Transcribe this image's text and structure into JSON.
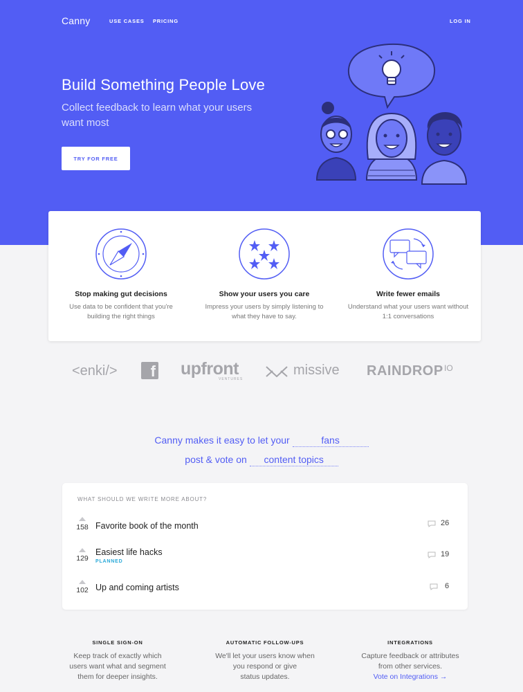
{
  "header": {
    "logo": "Canny",
    "nav": [
      "USE CASES",
      "PRICING"
    ],
    "login": "LOG IN"
  },
  "hero": {
    "title": "Build Something People Love",
    "subtitle": "Collect feedback to learn what your users want most",
    "cta": "TRY FOR FREE",
    "illustration": "people-with-lightbulb-speech-bubble"
  },
  "features": [
    {
      "icon": "compass-icon",
      "title": "Stop making gut decisions",
      "desc": "Use data to be confident that you're building the right things"
    },
    {
      "icon": "stars-icon",
      "title": "Show your users you care",
      "desc": "Impress your users by simply listening to what they have to say."
    },
    {
      "icon": "chat-bubbles-icon",
      "title": "Write fewer emails",
      "desc": "Understand what your users want without 1:1 conversations"
    }
  ],
  "logos": {
    "enki": "<enki/>",
    "facebook": "f",
    "upfront": "upfront",
    "upfront_sub": "VENTURES",
    "missive": "missive",
    "raindrop": "RAINDROP",
    "raindrop_sup": "IO"
  },
  "tagline": {
    "line1": "Canny makes it easy to let your",
    "word1": "fans",
    "line2": "post & vote on",
    "word2": "content topics"
  },
  "board": {
    "header": "WHAT SHOULD WE WRITE MORE ABOUT?",
    "posts": [
      {
        "votes": "158",
        "title": "Favorite book of the month",
        "status": "",
        "comments": "26"
      },
      {
        "votes": "129",
        "title": "Easiest life hacks",
        "status": "PLANNED",
        "comments": "19"
      },
      {
        "votes": "102",
        "title": "Up and coming artists",
        "status": "",
        "comments": "6"
      }
    ]
  },
  "info": [
    {
      "title": "SINGLE SIGN-ON",
      "desc_lines": [
        "Keep track of exactly which",
        "users want what and segment",
        "them for deeper insights."
      ],
      "link": ""
    },
    {
      "title": "AUTOMATIC FOLLOW-UPS",
      "desc_lines": [
        "We'll let your users know when",
        "you respond or give",
        "status updates."
      ],
      "link": ""
    },
    {
      "title": "INTEGRATIONS",
      "desc_lines": [
        "Capture feedback or attributes",
        "from other services."
      ],
      "link": "Vote on Integrations →"
    }
  ],
  "colors": {
    "brand": "#525df4",
    "planned": "#27a8d8",
    "background": "#f4f4f6"
  }
}
